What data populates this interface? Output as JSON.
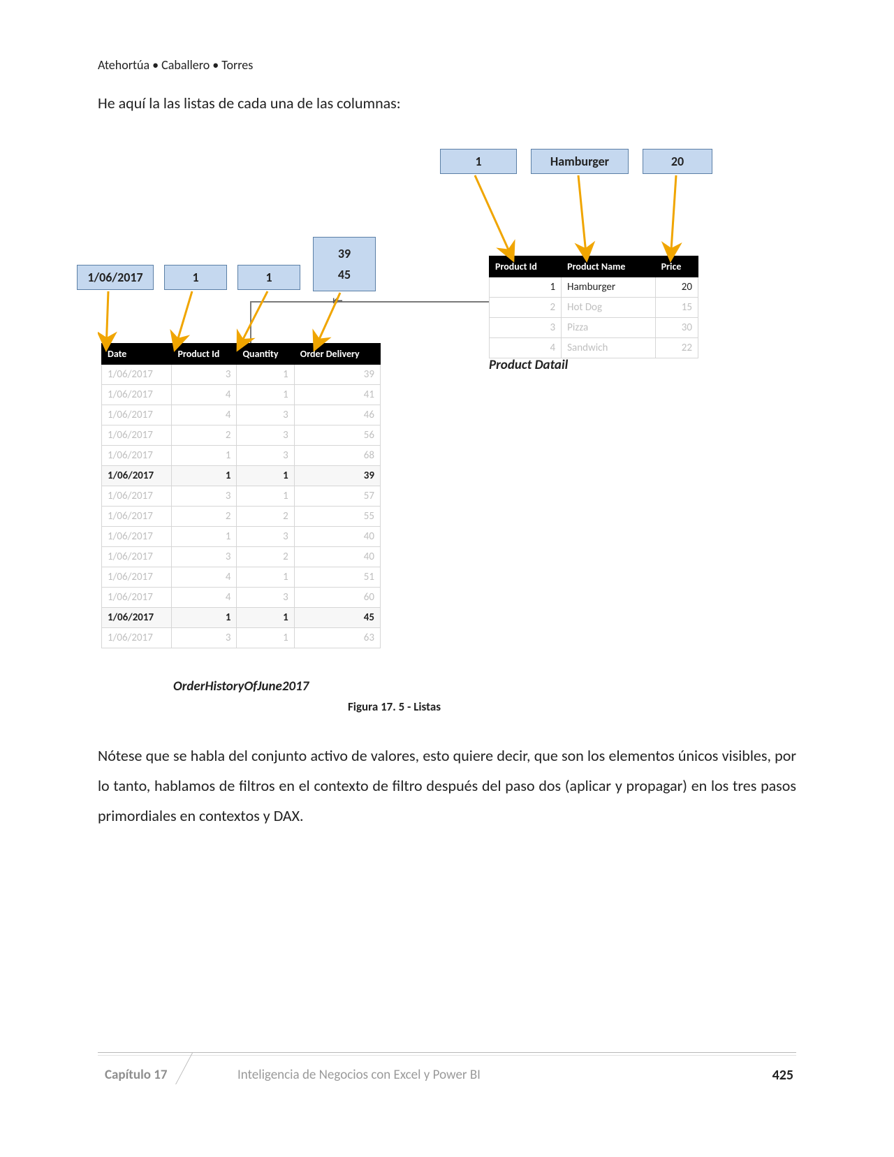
{
  "authors": "Atehortúa • Caballero • Torres",
  "intro": "He aquí la las listas de cada una de las columnas:",
  "tags": {
    "date": "1/06/2017",
    "prodid": "1",
    "qty": "1",
    "delivery1": "39",
    "delivery2": "45",
    "p_prodid": "1",
    "p_name": "Hamburger",
    "p_price": "20"
  },
  "orderTable": {
    "caption": "OrderHistoryOfJune2017",
    "headers": [
      "Date",
      "Product Id",
      "Quantity",
      "Order Delivery"
    ],
    "rows": [
      {
        "d": "1/06/2017",
        "p": "3",
        "q": "1",
        "o": "39",
        "hl": false
      },
      {
        "d": "1/06/2017",
        "p": "4",
        "q": "1",
        "o": "41",
        "hl": false
      },
      {
        "d": "1/06/2017",
        "p": "4",
        "q": "3",
        "o": "46",
        "hl": false
      },
      {
        "d": "1/06/2017",
        "p": "2",
        "q": "3",
        "o": "56",
        "hl": false
      },
      {
        "d": "1/06/2017",
        "p": "1",
        "q": "3",
        "o": "68",
        "hl": false
      },
      {
        "d": "1/06/2017",
        "p": "1",
        "q": "1",
        "o": "39",
        "hl": true
      },
      {
        "d": "1/06/2017",
        "p": "3",
        "q": "1",
        "o": "57",
        "hl": false
      },
      {
        "d": "1/06/2017",
        "p": "2",
        "q": "2",
        "o": "55",
        "hl": false
      },
      {
        "d": "1/06/2017",
        "p": "1",
        "q": "3",
        "o": "40",
        "hl": false
      },
      {
        "d": "1/06/2017",
        "p": "3",
        "q": "2",
        "o": "40",
        "hl": false
      },
      {
        "d": "1/06/2017",
        "p": "4",
        "q": "1",
        "o": "51",
        "hl": false
      },
      {
        "d": "1/06/2017",
        "p": "4",
        "q": "3",
        "o": "60",
        "hl": false
      },
      {
        "d": "1/06/2017",
        "p": "1",
        "q": "1",
        "o": "45",
        "hl": true
      },
      {
        "d": "1/06/2017",
        "p": "3",
        "q": "1",
        "o": "63",
        "hl": false
      }
    ]
  },
  "productTable": {
    "caption": "Product Datail",
    "headers": [
      "Product Id",
      "Product Name",
      "Price"
    ],
    "rows": [
      {
        "id": "1",
        "n": "Hamburger",
        "pr": "20",
        "hl": true
      },
      {
        "id": "2",
        "n": "Hot Dog",
        "pr": "15",
        "hl": false
      },
      {
        "id": "3",
        "n": "Pizza",
        "pr": "30",
        "hl": false
      },
      {
        "id": "4",
        "n": "Sandwich",
        "pr": "22",
        "hl": false
      }
    ]
  },
  "figCaption": "Figura 17. 5 - Listas",
  "para2": "Nótese que se habla del conjunto activo de valores, esto quiere decir, que son los elementos únicos visibles, por lo tanto, hablamos de filtros en el contexto de filtro después del paso dos (aplicar y propagar) en los tres pasos primordiales en contextos y DAX.",
  "footer": {
    "chapter": "Capítulo 17",
    "title": "Inteligencia de Negocios con Excel y Power BI",
    "page": "425"
  }
}
